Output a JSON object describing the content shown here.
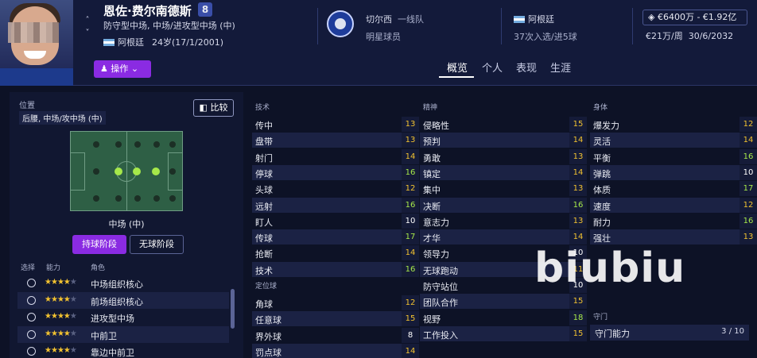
{
  "header": {
    "name": "恩佐·费尔南德斯",
    "number": "8",
    "positions": "防守型中场, 中场/进攻型中场 (中)",
    "nationality": "阿根廷",
    "age": "24岁(17/1/2001)",
    "action_button": "操作",
    "club": "切尔西",
    "club_role": "明星球员",
    "league_tier": "一线队",
    "national_team": "阿根廷",
    "caps": "37次入选/进5球",
    "value": "€6400万 - €1.92亿",
    "wage": "€21万/周",
    "contract": "30/6/2032"
  },
  "tabs": [
    "概览",
    "个人",
    "表现",
    "生涯"
  ],
  "left": {
    "position_label": "位置",
    "position_detail": "后腰, 中场/攻中场 (中)",
    "compare_label": "比较",
    "pitch_position": "中场 (中)",
    "phase_in": "持球阶段",
    "phase_out": "无球阶段",
    "col_select": "选择",
    "col_ability": "能力",
    "col_role": "角色",
    "roles": [
      {
        "name": "中场组织核心",
        "stars": 4
      },
      {
        "name": "前场组织核心",
        "stars": 4
      },
      {
        "name": "进攻型中场",
        "stars": 4
      },
      {
        "name": "中前卫",
        "stars": 4
      },
      {
        "name": "靠边中前卫",
        "stars": 4
      }
    ]
  },
  "technical": {
    "title": "技术",
    "attrs": [
      {
        "n": "传中",
        "v": "13"
      },
      {
        "n": "盘带",
        "v": "13"
      },
      {
        "n": "射门",
        "v": "14"
      },
      {
        "n": "停球",
        "v": "16"
      },
      {
        "n": "头球",
        "v": "12"
      },
      {
        "n": "远射",
        "v": "16"
      },
      {
        "n": "盯人",
        "v": "10"
      },
      {
        "n": "传球",
        "v": "17"
      },
      {
        "n": "抢断",
        "v": "14"
      },
      {
        "n": "技术",
        "v": "16"
      }
    ]
  },
  "setpieces": {
    "title": "定位球",
    "attrs": [
      {
        "n": "角球",
        "v": "12"
      },
      {
        "n": "任意球",
        "v": "15"
      },
      {
        "n": "界外球",
        "v": "8"
      },
      {
        "n": "罚点球",
        "v": "14"
      }
    ]
  },
  "mental": {
    "title": "精神",
    "attrs": [
      {
        "n": "侵略性",
        "v": "15"
      },
      {
        "n": "预判",
        "v": "14"
      },
      {
        "n": "勇敢",
        "v": "13"
      },
      {
        "n": "镇定",
        "v": "14"
      },
      {
        "n": "集中",
        "v": "13"
      },
      {
        "n": "决断",
        "v": "16"
      },
      {
        "n": "意志力",
        "v": "13"
      },
      {
        "n": "才华",
        "v": "14"
      },
      {
        "n": "领导力",
        "v": "10"
      },
      {
        "n": "无球跑动",
        "v": "11"
      },
      {
        "n": "防守站位",
        "v": "10"
      },
      {
        "n": "团队合作",
        "v": "15"
      },
      {
        "n": "视野",
        "v": "18"
      },
      {
        "n": "工作投入",
        "v": "15"
      }
    ]
  },
  "physical": {
    "title": "身体",
    "attrs": [
      {
        "n": "爆发力",
        "v": "12"
      },
      {
        "n": "灵活",
        "v": "14"
      },
      {
        "n": "平衡",
        "v": "16"
      },
      {
        "n": "弹跳",
        "v": "10"
      },
      {
        "n": "体质",
        "v": "17"
      },
      {
        "n": "速度",
        "v": "12"
      },
      {
        "n": "耐力",
        "v": "16"
      },
      {
        "n": "强壮",
        "v": "13"
      }
    ]
  },
  "goalkeeping": {
    "title": "守门",
    "label": "守门能力",
    "value": "3 / 10"
  },
  "watermark": "biubiu",
  "colors": {
    "accent": "#8a2be2",
    "green": "#a6e84a",
    "yellow": "#f2c230",
    "white": "#ffffff"
  }
}
